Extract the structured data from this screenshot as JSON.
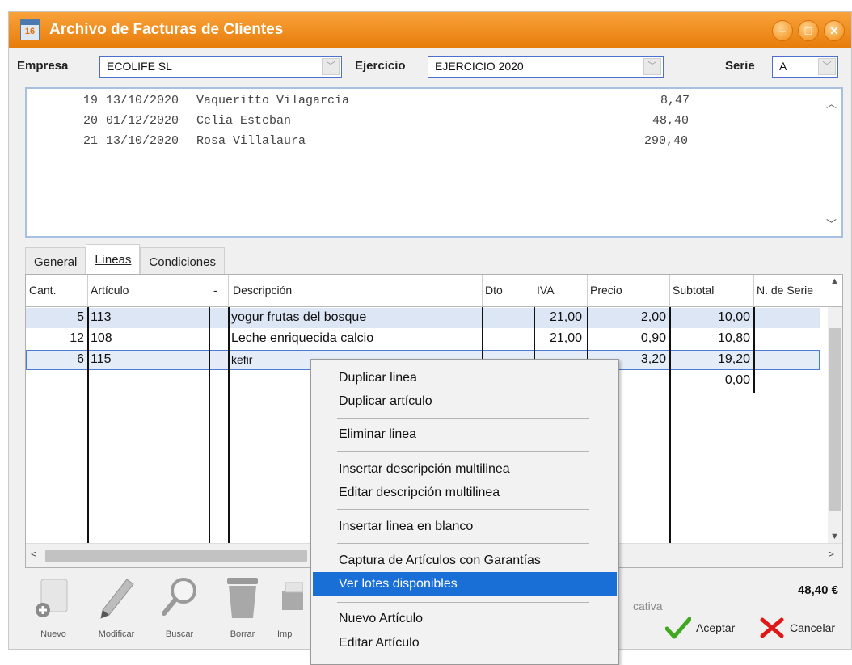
{
  "window": {
    "title": "Archivo de Facturas de Clientes",
    "icon_text": "16"
  },
  "filters": {
    "empresa_label": "Empresa",
    "empresa_value": "ECOLIFE SL",
    "ejercicio_label": "Ejercicio",
    "ejercicio_value": "EJERCICIO 2020",
    "serie_label": "Serie",
    "serie_value": "A"
  },
  "invoices": [
    {
      "num": "19",
      "date": "13/10/2020",
      "client": "Vaqueritto Vilagarcía",
      "amount": "8,47"
    },
    {
      "num": "20",
      "date": "01/12/2020",
      "client": "Celia Esteban",
      "amount": "48,40"
    },
    {
      "num": "21",
      "date": "13/10/2020",
      "client": "Rosa Villalaura",
      "amount": "290,40"
    }
  ],
  "tabs": [
    {
      "label": "General",
      "active": false
    },
    {
      "label": "Líneas",
      "active": true
    },
    {
      "label": "Condiciones",
      "active": false
    }
  ],
  "grid": {
    "columns": [
      "Cant.",
      "Artículo",
      "-",
      "Descripción",
      "Dto",
      "IVA",
      "Precio",
      "Subtotal",
      "N. de Serie"
    ],
    "rows": [
      {
        "cant": "5",
        "articulo": "113",
        "descripcion": "yogur frutas del bosque",
        "iva": "21,00",
        "precio": "2,00",
        "subtotal": "10,00"
      },
      {
        "cant": "12",
        "articulo": "108",
        "descripcion": "Leche enriquecida calcio",
        "iva": "21,00",
        "precio": "0,90",
        "subtotal": "10,80"
      },
      {
        "cant": "6",
        "articulo": "115",
        "descripcion": "kefir",
        "iva": "",
        "precio": "3,20",
        "subtotal": "19,20"
      },
      {
        "cant": "",
        "articulo": "",
        "descripcion": "",
        "iva": "",
        "precio": "",
        "subtotal": "0,00"
      }
    ]
  },
  "context_menu": [
    "Duplicar linea",
    "Duplicar artículo",
    "Eliminar linea",
    "Insertar descripción multilinea",
    "Editar descripción multilinea",
    "Insertar linea en blanco",
    "Captura de Artículos con Garantías",
    "Ver lotes disponibles",
    "Nuevo Artículo",
    "Editar Artículo"
  ],
  "context_menu_highlighted": "Ver lotes disponibles",
  "toolbar": {
    "nuevo": "Nuevo",
    "modificar": "Modificar",
    "buscar": "Buscar",
    "borrar": "Borrar",
    "imprimir_partial": "Imp"
  },
  "footer": {
    "partial_text": "cativa",
    "total": "48,40 €",
    "aceptar": "Aceptar",
    "cancelar": "Cancelar"
  },
  "colors": {
    "titlebar": "#f08a10",
    "highlight": "#1a6fd6",
    "selected_row": "#dce6f5"
  },
  "icons": [
    "app-calendar-icon",
    "minimize-icon",
    "maximize-icon",
    "close-icon",
    "new-document-icon",
    "pen-icon",
    "magnifier-icon",
    "trash-icon",
    "printer-icon",
    "checkmark-icon",
    "red-x-icon"
  ]
}
